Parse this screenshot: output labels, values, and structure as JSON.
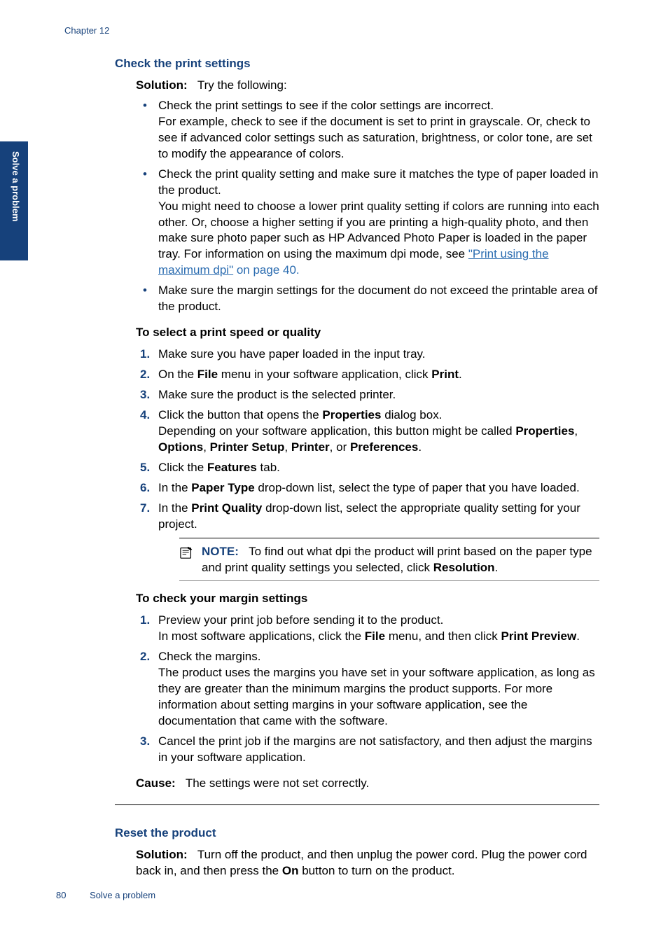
{
  "chapter": "Chapter 12",
  "side_tab": "Solve a problem",
  "section1": {
    "title": "Check the print settings",
    "solution_label": "Solution:",
    "solution_text": "Try the following:",
    "bullets": {
      "b1a": "Check the print settings to see if the color settings are incorrect.",
      "b1b": "For example, check to see if the document is set to print in grayscale. Or, check to see if advanced color settings such as saturation, brightness, or color tone, are set to modify the appearance of colors.",
      "b2a": "Check the print quality setting and make sure it matches the type of paper loaded in the product.",
      "b2b_pre": "You might need to choose a lower print quality setting if colors are running into each other. Or, choose a higher setting if you are printing a high-quality photo, and then make sure photo paper such as HP Advanced Photo Paper is loaded in the paper tray. For information on using the maximum dpi mode, see ",
      "b2b_link": "\"Print using the maximum dpi\"",
      "b2b_post": " on page 40.",
      "b3": "Make sure the margin settings for the document do not exceed the printable area of the product."
    },
    "sub1_title": "To select a print speed or quality",
    "steps1": {
      "s1": "Make sure you have paper loaded in the input tray.",
      "s2_pre": "On the ",
      "s2_b1": "File",
      "s2_mid": " menu in your software application, click ",
      "s2_b2": "Print",
      "s2_post": ".",
      "s3": "Make sure the product is the selected printer.",
      "s4_pre": "Click the button that opens the ",
      "s4_b": "Properties",
      "s4_post": " dialog box.",
      "s4b_pre": "Depending on your software application, this button might be called ",
      "s4b_b1": "Properties",
      "s4b_c1": ", ",
      "s4b_b2": "Options",
      "s4b_c2": ", ",
      "s4b_b3": "Printer Setup",
      "s4b_c3": ", ",
      "s4b_b4": "Printer",
      "s4b_c4": ", or ",
      "s4b_b5": "Preferences",
      "s4b_post": ".",
      "s5_pre": "Click the ",
      "s5_b": "Features",
      "s5_post": " tab.",
      "s6_pre": "In the ",
      "s6_b": "Paper Type",
      "s6_post": " drop-down list, select the type of paper that you have loaded.",
      "s7_pre": "In the ",
      "s7_b": "Print Quality",
      "s7_post": " drop-down list, select the appropriate quality setting for your project."
    },
    "note": {
      "label": "NOTE:",
      "text_pre": "To find out what dpi the product will print based on the paper type and print quality settings you selected, click ",
      "text_b": "Resolution",
      "text_post": "."
    },
    "sub2_title": "To check your margin settings",
    "steps2": {
      "s1a": "Preview your print job before sending it to the product.",
      "s1b_pre": "In most software applications, click the ",
      "s1b_b1": "File",
      "s1b_mid": " menu, and then click ",
      "s1b_b2": "Print Preview",
      "s1b_post": ".",
      "s2a": "Check the margins.",
      "s2b": "The product uses the margins you have set in your software application, as long as they are greater than the minimum margins the product supports. For more information about setting margins in your software application, see the documentation that came with the software.",
      "s3": "Cancel the print job if the margins are not satisfactory, and then adjust the margins in your software application."
    },
    "cause_label": "Cause:",
    "cause_text": "The settings were not set correctly."
  },
  "section2": {
    "title": "Reset the product",
    "solution_label": "Solution:",
    "text_pre": "Turn off the product, and then unplug the power cord. Plug the power cord back in, and then press the ",
    "text_b": "On",
    "text_post": " button to turn on the product."
  },
  "footer": {
    "page": "80",
    "title": "Solve a problem"
  }
}
